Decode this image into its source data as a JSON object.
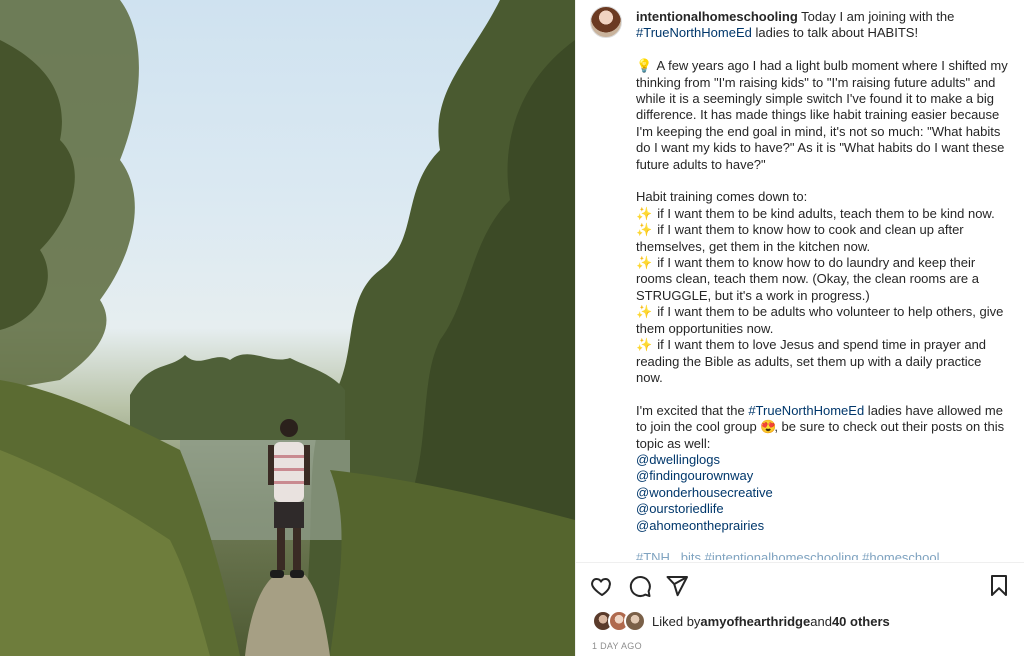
{
  "author": {
    "username": "intentionalhomeschooling"
  },
  "caption": {
    "intro_text": " Today I am joining with the ",
    "intro_tag": "#TrueNorthHomeEd",
    "intro_tail": " ladies to talk about HABITS!",
    "para1": "A few years ago I had a light bulb moment where I shifted my thinking from \"I'm raising kids\" to \"I'm raising future adults\" and while it is a seemingly simple switch I've found it to make a big difference. It has made things like habit training easier because I'm keeping the end goal in mind, it's not so much: \"What habits do I want my kids to have?\" As it is \"What habits do I want these future adults to have?\"",
    "habit_heading": "Habit training comes down to:",
    "habits": [
      "if I want them to be kind adults, teach them to be kind now.",
      "if I want them to know how to cook and clean up after themselves, get them in the kitchen now.",
      "if I want them to know how to do laundry and keep their rooms clean, teach them now. (Okay, the clean rooms are a STRUGGLE, but it's a work in progress.)",
      "if I want them to be adults who volunteer to help others, give them opportunities now.",
      "if I want them to love Jesus and spend time in prayer and reading the Bible as adults, set them up with a daily practice now."
    ],
    "closing_pre": "I'm excited that the ",
    "closing_tag": "#TrueNorthHomeEd",
    "closing_post": " ladies have allowed me to join the cool group ",
    "closing_end": ", be sure to check out their posts on this topic as well:",
    "mentions": [
      "@dwellinglogs",
      "@findingourownway",
      "@wonderhousecreative",
      "@ourstoriedlife",
      "@ahomeontheprairies"
    ],
    "cut_off": "#TNH...bits #intentionalhomeschooling #homeschool..."
  },
  "emoji": {
    "bulb": "💡",
    "sparkle": "✨",
    "heart_eyes": "😍"
  },
  "actions": {
    "like_icon": "heart-icon",
    "comment_icon": "comment-icon",
    "share_icon": "share-icon",
    "save_icon": "bookmark-icon"
  },
  "likes": {
    "prefix": "Liked by ",
    "user": "amyofhearthridge",
    "middle": " and ",
    "others": "40 others"
  },
  "timestamp": "1 DAY AGO",
  "colors": {
    "link": "#00376b",
    "text": "#262626",
    "muted": "#8e8e8e"
  }
}
